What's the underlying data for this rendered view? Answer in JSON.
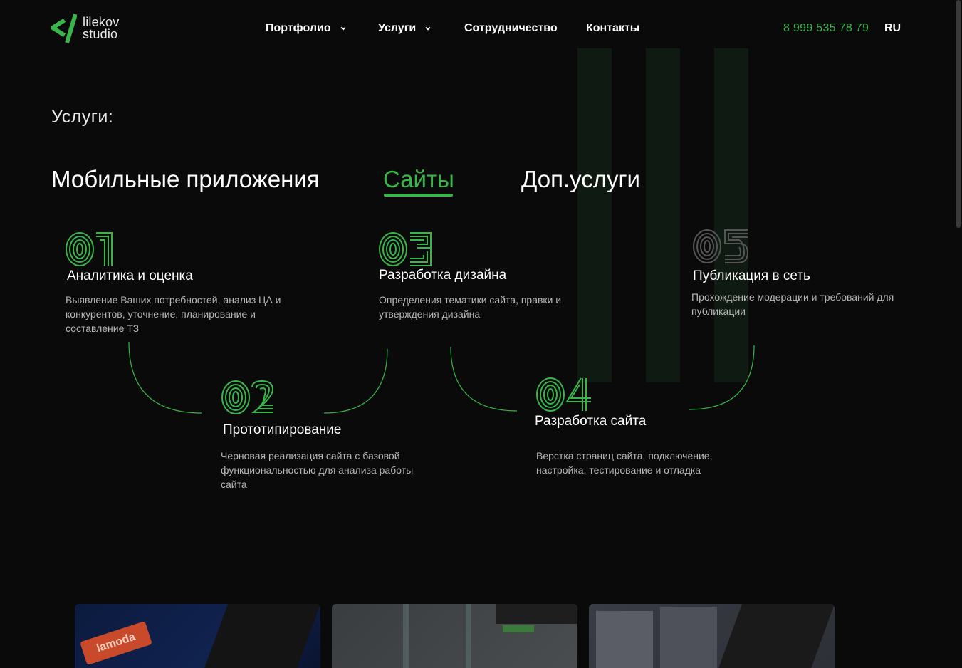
{
  "header": {
    "logo": {
      "line1": "lilekov",
      "line2": "studio",
      "accent_color": "#3ab54a"
    },
    "nav": [
      {
        "label": "Портфолио",
        "has_dropdown": true
      },
      {
        "label": "Услуги",
        "has_dropdown": true
      },
      {
        "label": "Сотрудничество",
        "has_dropdown": false
      },
      {
        "label": "Контакты",
        "has_dropdown": false
      }
    ],
    "phone": "8 999 535 78 79",
    "language": "RU"
  },
  "services": {
    "title": "Услуги:",
    "tabs": [
      {
        "label": "Мобильные приложения",
        "active": false
      },
      {
        "label": "Сайты",
        "active": true
      },
      {
        "label": "Доп.услуги",
        "active": false
      }
    ],
    "steps": [
      {
        "number": "01",
        "title": "Аналитика и оценка",
        "description": "Выявление Ваших потребностей, анализ ЦА и конкурентов, уточнение, планирование и составление ТЗ",
        "state": "done"
      },
      {
        "number": "02",
        "title": "Прототипирование",
        "description": "Черновая реализация сайта с базовой функциональностью для анализа работы сайта",
        "state": "done"
      },
      {
        "number": "03",
        "title": "Разработка дизайна",
        "description": "Определения тематики сайта, правки и утверждения дизайна",
        "state": "done"
      },
      {
        "number": "04",
        "title": "Разработка сайта",
        "description": "Верстка страниц сайта, подключение, настройка, тестирование и отладка",
        "state": "done"
      },
      {
        "number": "05",
        "title": "Публикация в сеть",
        "description": "Прохождение модерации и требований для публикации",
        "state": "pending"
      }
    ]
  },
  "portfolio": {
    "cards": [
      {
        "badge": "lamoda"
      },
      {
        "badge": ""
      },
      {
        "badge": ""
      }
    ]
  },
  "colors": {
    "background": "#0a0a0a",
    "accent": "#3ab54a",
    "pending": "#555555"
  }
}
